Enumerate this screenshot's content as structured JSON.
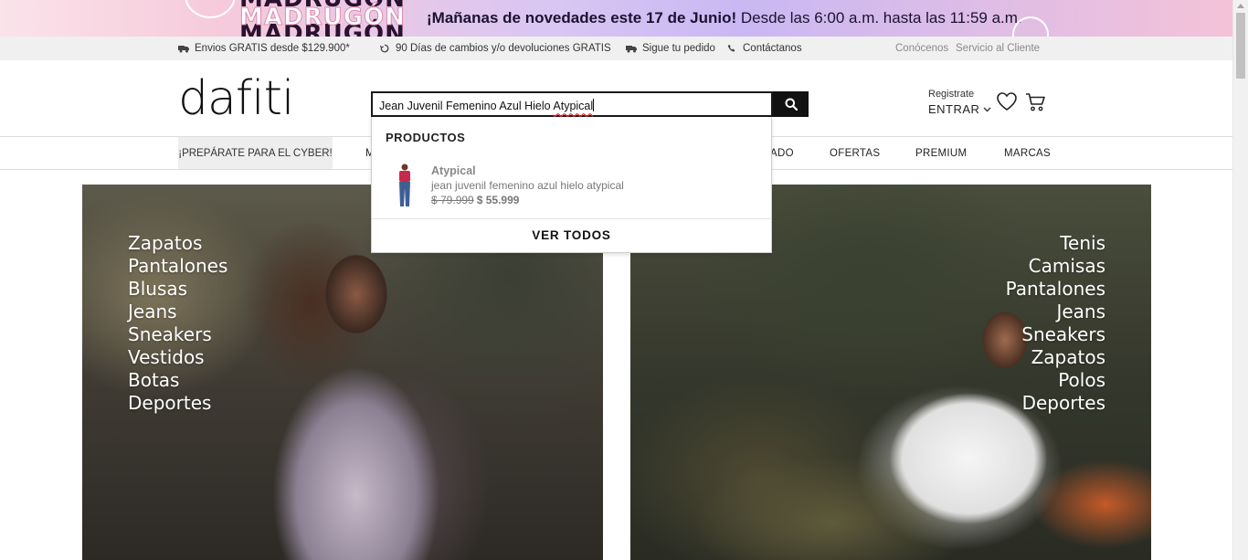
{
  "promo": {
    "brand_word": "MADRUGÓN",
    "message_bold": "¡Mañanas de novedades este 17 de Junio!",
    "message_rest": " Desde las 6:00 a.m. hasta las 11:59 a.m."
  },
  "utility": {
    "shipping": "Envios GRATIS desde $129.900*",
    "returns": "90 Días de cambios y/o devoluciones GRATIS",
    "track": "Sigue tu pedido",
    "contact": "Contáctanos",
    "about": "Conócenos",
    "service": "Servicio al Cliente"
  },
  "header": {
    "logo": "dafiti",
    "search_value_plain": "Jean Juvenil Femenino Azul Hielo ",
    "search_value_flagged": "Atypical",
    "account_register": "Registrate",
    "account_enter": "ENTRAR"
  },
  "nav": {
    "cyber": "¡PREPÁRATE PARA EL CYBER!",
    "partial_left": "M",
    "partial_right": "ADO",
    "offers": "OFERTAS",
    "premium": "PREMIUM",
    "brands": "MARCAS"
  },
  "suggestions": {
    "section_title": "PRODUCTOS",
    "product": {
      "brand": "Atypical",
      "name": "jean juvenil femenino azul hielo atypical",
      "old_price": "$ 79.999",
      "new_price": "$ 55.999"
    },
    "see_all": "VER TODOS"
  },
  "hero_women": {
    "categories": [
      "Zapatos",
      "Pantalones",
      "Blusas",
      "Jeans",
      "Sneakers",
      "Vestidos",
      "Botas",
      "Deportes"
    ]
  },
  "hero_men": {
    "categories": [
      "Tenis",
      "Camisas",
      "Pantalones",
      "Jeans",
      "Sneakers",
      "Zapatos",
      "Polos",
      "Deportes"
    ]
  },
  "colors": {
    "accent_black": "#111111",
    "utility_bg": "#f0f0f0",
    "price_gray": "#777777"
  },
  "icons": [
    "truck-icon",
    "refresh-icon",
    "truck-icon",
    "phone-icon",
    "search-icon",
    "chevron-down-icon",
    "heart-icon",
    "cart-icon"
  ]
}
